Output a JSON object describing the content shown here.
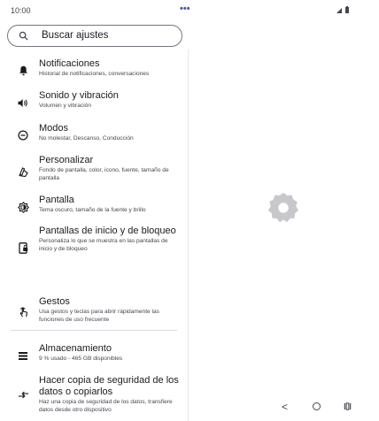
{
  "status_bar": {
    "time": "10:00",
    "dots": "•••",
    "icons": [
      "signal-icon",
      "battery-icon"
    ]
  },
  "search": {
    "placeholder": "Buscar ajustes"
  },
  "settings": [
    {
      "icon": "bell-icon",
      "title": "Notificaciones",
      "subtitle": "Historial de notificaciones, conversaciones"
    },
    {
      "icon": "volume-icon",
      "title": "Sonido y vibración",
      "subtitle": "Volumen y vibración"
    },
    {
      "icon": "modes-icon",
      "title": "Modos",
      "subtitle": "No molestar, Descanso, Conducción"
    },
    {
      "icon": "palette-icon",
      "title": "Personalizar",
      "subtitle": "Fondo de pantalla, color, icono, fuente, tamaño de pantalla"
    },
    {
      "icon": "brightness-icon",
      "title": "Pantalla",
      "subtitle": "Tema oscuro, tamaño de la fuente y brillo"
    },
    {
      "icon": "lock-screen-icon",
      "title": "Pantallas de inicio y de bloqueo",
      "subtitle": "Personaliza lo que se muestra en las pantallas de inicio y de bloqueo"
    },
    {
      "icon": "gesture-icon",
      "title": "Gestos",
      "subtitle": "Usa gestos y teclas para abrir rápidamente las funciones de uso frecuente"
    },
    {
      "icon": "storage-icon",
      "title": "Almacenamiento",
      "subtitle": "9 % usado - 465 GB disponibles"
    },
    {
      "icon": "backup-icon",
      "title": "Hacer copia de seguridad de los datos o copiarlos",
      "subtitle": "Haz una copia de seguridad de los datos, transfiere datos desde otro dispositivo"
    }
  ],
  "right_pane": {
    "icon": "settings-gear-icon"
  },
  "nav_bar": {
    "back": "<",
    "home": "home-icon",
    "recents": "recents-icon"
  }
}
